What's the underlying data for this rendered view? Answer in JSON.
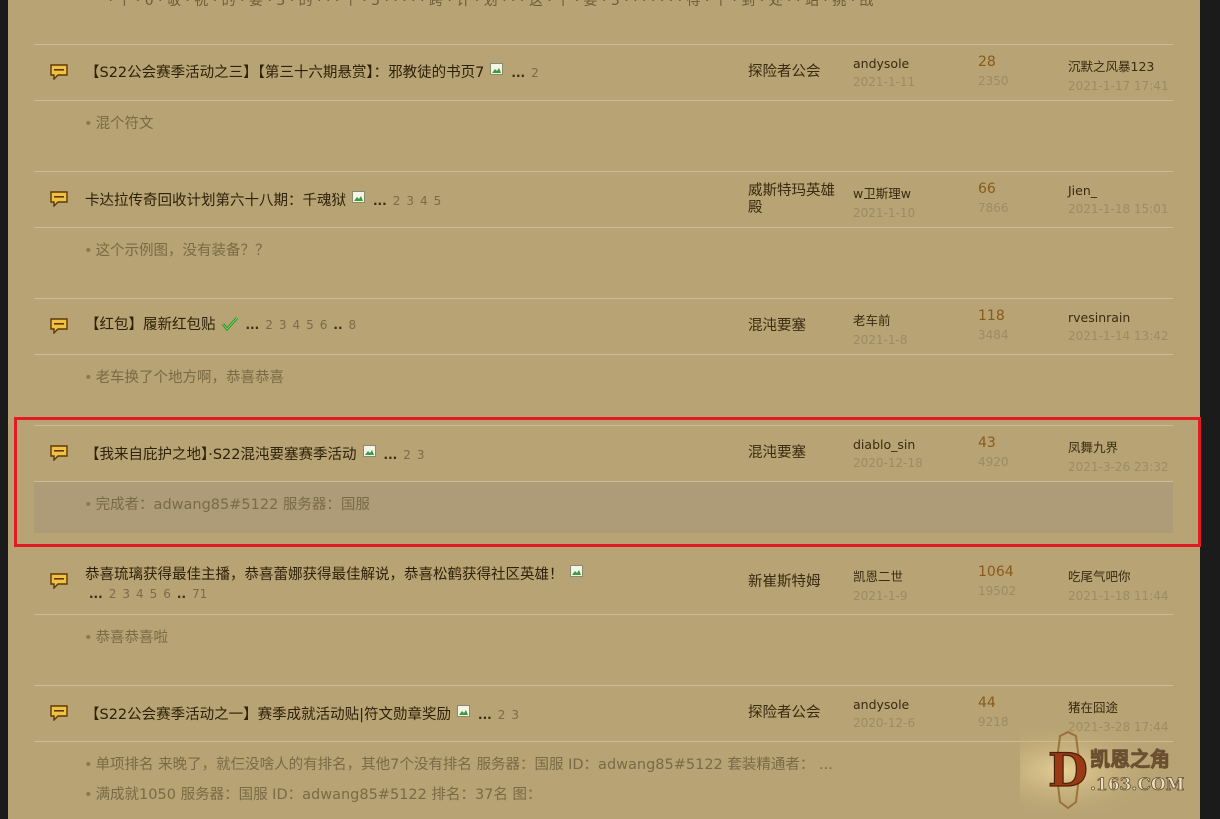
{
  "top_cut_text": "一 · 个 · 0 · 敬 · 祝 · 的 · 要 · 3 · 的 · · · 个 · 5 · · · · · 跨 · 计 · 划 · · · 这 · 个 · 要 · 3 · · · · · · · 得 · 个 · 到 · 处 · · 站 · 挑 · 战",
  "threads": [
    {
      "title": "【S22公会赛季活动之三】【第三十六期悬赏】：邪教徒的书页7",
      "has_image": true,
      "has_check": false,
      "pages_dots": "...",
      "pages": [
        "2"
      ],
      "forum": "探险者公会",
      "author": "andysole",
      "date": "2021-1-11",
      "replies": "28",
      "views": "2350",
      "last_user": "沉默之风暴123",
      "last_time": "2021-1-17 17:41",
      "previews": [
        "混个符文"
      ]
    },
    {
      "title": "卡达拉传奇回收计划第六十八期：千魂狱",
      "has_image": true,
      "has_check": false,
      "pages_dots": "...",
      "pages": [
        "2",
        "3",
        "4",
        "5"
      ],
      "forum": "威斯特玛英雄殿",
      "author": "w卫斯理w",
      "date": "2021-1-10",
      "replies": "66",
      "views": "7866",
      "last_user": "Jien_",
      "last_time": "2021-1-18 15:01",
      "previews": [
        "这个示例图，没有装备？？"
      ]
    },
    {
      "title": "【红包】履新红包贴",
      "has_image": false,
      "has_check": true,
      "pages_dots": "...",
      "pages": [
        "2",
        "3",
        "4",
        "5",
        "6",
        "..",
        "8"
      ],
      "forum": "混沌要塞",
      "author": "老车前",
      "date": "2021-1-8",
      "replies": "118",
      "views": "3484",
      "last_user": "rvesinrain",
      "last_time": "2021-1-14 13:42",
      "previews": [
        "老车换了个地方啊，恭喜恭喜"
      ]
    },
    {
      "title": "【我来自庇护之地】·S22混沌要塞赛季活动",
      "has_image": true,
      "has_check": false,
      "pages_dots": "...",
      "pages": [
        "2",
        "3"
      ],
      "forum": "混沌要塞",
      "author": "diablo_sin",
      "date": "2020-12-18",
      "replies": "43",
      "views": "4920",
      "last_user": "凤舞九界",
      "last_time": "2021-3-26 23:32",
      "previews": [
        "完成者：adwang85#5122 服务器：国服"
      ]
    },
    {
      "title": "恭喜琉璃获得最佳主播，恭喜蕾娜获得最佳解说，恭喜松鹤获得社区英雄！",
      "has_image": true,
      "has_check": false,
      "pages_dots": "...",
      "pages": [
        "2",
        "3",
        "4",
        "5",
        "6",
        "..",
        "71"
      ],
      "forum": "新崔斯特姆",
      "author": "凯恩二世",
      "date": "2021-1-9",
      "replies": "1064",
      "views": "19502",
      "last_user": "吃尾气吧你",
      "last_time": "2021-1-18 11:44",
      "previews": [
        "恭喜恭喜啦"
      ]
    },
    {
      "title": "【S22公会赛季活动之一】赛季成就活动贴|符文勋章奖励",
      "has_image": true,
      "has_check": false,
      "pages_dots": "...",
      "pages": [
        "2",
        "3"
      ],
      "forum": "探险者公会",
      "author": "andysole",
      "date": "2020-12-6",
      "replies": "44",
      "views": "9218",
      "last_user": "猪在囧途",
      "last_time": "2021-3-28 17:44",
      "previews": [
        "单项排名 来晚了，就仨没啥人的有排名，其他7个没有排名 服务器：国服 ID：adwang85#5122 套装精通者： ...",
        "满成就1050 服务器：国服 ID：adwang85#5122 排名：37名 图："
      ]
    }
  ],
  "watermark": {
    "letter": "D",
    "site_name": "凯恩之角",
    "domain": ".163.COM"
  },
  "colors": {
    "background": "#b7a373",
    "highlight_row": "#ae9c78",
    "red_outline": "#e11b22",
    "reply_count": "#8a5a18"
  },
  "icons": {
    "thread": "speech-bubble-icon",
    "image": "image-attachment-icon",
    "check": "green-check-icon"
  }
}
